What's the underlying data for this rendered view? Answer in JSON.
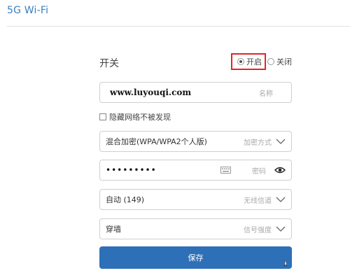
{
  "page": {
    "title": "5G Wi-Fi"
  },
  "switch": {
    "label": "开关",
    "on_label": "开启",
    "off_label": "关闭",
    "selected": "on"
  },
  "ssid": {
    "value": "www.luyouqi.com",
    "hint": "名称"
  },
  "hide_network": {
    "label": "隐藏网络不被发现",
    "checked": false
  },
  "encryption": {
    "value": "混合加密(WPA/WPA2个人版)",
    "hint": "加密方式",
    "icon": "chevron-down-icon"
  },
  "password": {
    "value": "•••••••••",
    "hint": "密码",
    "icons": [
      "keyboard-icon",
      "eye-icon"
    ]
  },
  "channel": {
    "value": "自动 (149)",
    "hint": "无线信道",
    "icon": "chevron-down-icon"
  },
  "signal_strength": {
    "value": "穿墙",
    "hint": "信号强度",
    "icon": "chevron-down-icon"
  },
  "save_button": {
    "label": "保存"
  },
  "colors": {
    "accent": "#2e70b8",
    "title": "#3a7fc2",
    "highlight_border": "#e3232a"
  }
}
